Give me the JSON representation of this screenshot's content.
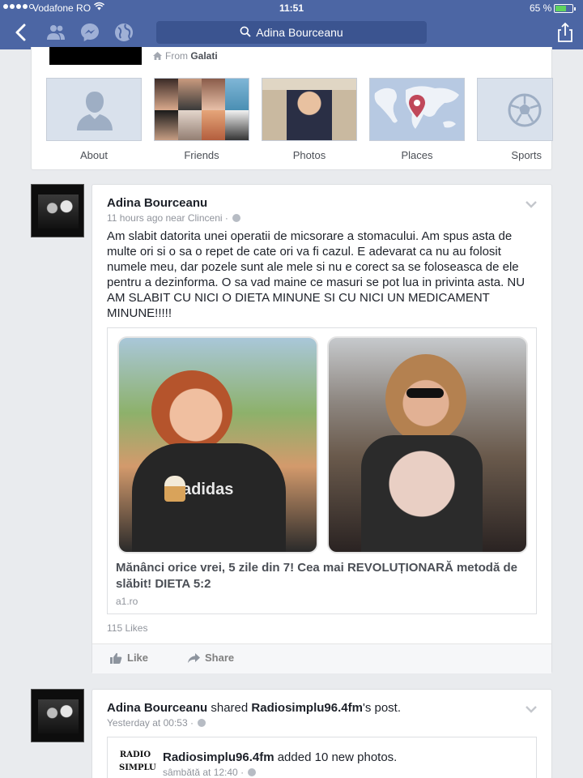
{
  "status_bar": {
    "carrier": "Vodafone RO",
    "time": "11:51",
    "battery": "65 %"
  },
  "nav": {
    "search_text": "Adina Bourceanu"
  },
  "profile": {
    "from_prefix": "From",
    "from_place": "Galati",
    "tiles": [
      {
        "label": "About"
      },
      {
        "label": "Friends"
      },
      {
        "label": "Photos"
      },
      {
        "label": "Places"
      },
      {
        "label": "Sports"
      }
    ]
  },
  "post1": {
    "author": "Adina Bourceanu",
    "meta": "11 hours ago near Clinceni ·",
    "text": "Am slabit datorita unei operatii de micsorare a stomacului. Am spus asta de multe ori si o sa o repet de cate ori va fi cazul. E adevarat ca nu au folosit numele meu, dar pozele sunt ale mele si nu e corect sa se foloseasca de ele pentru a dezinforma. O sa vad maine ce masuri se pot lua in privinta asta. NU AM SLABIT CU NICI O DIETA MINUNE SI CU NICI UN MEDICAMENT MINUNE!!!!!",
    "link": {
      "title": "Mănânci orice vrei, 5 zile din 7! Cea mai REVOLUȚIONARĂ metodă de slăbit! DIETA 5:2",
      "domain": "a1.ro",
      "shirt_text": "adidas"
    },
    "likes": "115 Likes",
    "like_label": "Like",
    "share_label": "Share"
  },
  "post2": {
    "author": "Adina Bourceanu",
    "shared_word": "shared",
    "page": "Radiosimplu96.4fm",
    "post_suffix": "'s post.",
    "meta": "Yesterday at 00:53 ·",
    "inner": {
      "logo_line1": "RADIO",
      "logo_line2": "SIMPLU",
      "name": "Radiosimplu96.4fm",
      "action": "added 10 new photos.",
      "meta": "sâmbătă at 12:40 ·"
    }
  },
  "colors": {
    "nav_blue": "#4c66a4",
    "search_blue": "#3b5490",
    "background": "#e9ebee",
    "battery_green": "#5fd35f"
  }
}
